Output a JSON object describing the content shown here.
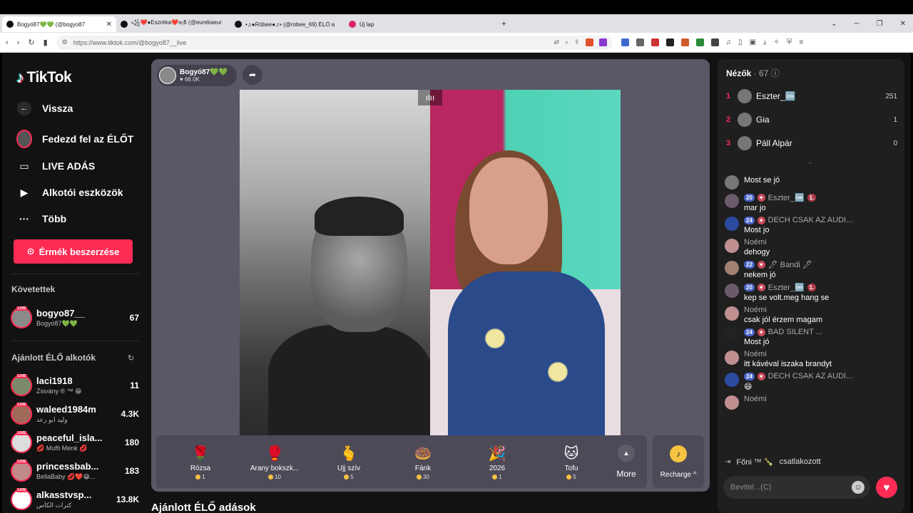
{
  "browser": {
    "tabs": [
      {
        "title": "Bogyó87💚💚 (@bogyo87"
      },
      {
        "title": "꧁❤️●Eszrèka❤️ʜ¡ϐ (@eurekaeur"
      },
      {
        "title": "•♫●Röbee●♫• (@robee_69) ÉLŐ a"
      },
      {
        "title": "Új lap"
      }
    ],
    "url": "https://www.tiktok.com/@bogyo87__live"
  },
  "sidebar": {
    "logo": "TikTok",
    "back": "Vissza",
    "explore": "Fedezd fel az ÉLŐT",
    "live": "LIVE ADÁS",
    "creator_tools": "Alkotói eszközök",
    "more": "Több",
    "coins_button": "Érmék beszerzése",
    "following_title": "Követettek",
    "following": [
      {
        "name": "bogyo87__",
        "sub": "Bogyó87💚💚",
        "count": "67",
        "color": "#8a8a8a"
      }
    ],
    "recommended_title": "Ajánlott ÉLŐ alkotók",
    "recommended": [
      {
        "name": "laci1918",
        "sub": "Zsivány ® ™ 😁",
        "count": "11",
        "color": "#7a8a6a"
      },
      {
        "name": "waleed1984m",
        "sub": "وليد ابو رعد",
        "count": "4.3K",
        "color": "#a06a5a"
      },
      {
        "name": "peaceful_isla...",
        "sub": "💋 Mufti Menk 💋",
        "count": "180",
        "color": "#ddd"
      },
      {
        "name": "princessbab...",
        "sub": "BellaBaby 💋❤️😁...",
        "count": "183",
        "color": "#c08a8a"
      },
      {
        "name": "alkasstvsp...",
        "sub": "كترات الكأس",
        "count": "13.8K",
        "color": "#fff"
      }
    ]
  },
  "stage": {
    "host_name": "Bogyó87💚💚",
    "host_likes": "♥ 66.0K",
    "gifts": [
      {
        "name": "Rózsa",
        "price": "1",
        "emoji": "🌹"
      },
      {
        "name": "Arany bokszk...",
        "price": "10",
        "emoji": "🥊"
      },
      {
        "name": "Ujj szív",
        "price": "5",
        "emoji": "🫰"
      },
      {
        "name": "Fánk",
        "price": "30",
        "emoji": "🍩"
      },
      {
        "name": "2026",
        "price": "1",
        "emoji": "🎉"
      },
      {
        "name": "Tofu",
        "price": "5",
        "emoji": "🐱"
      }
    ],
    "more_label": "More",
    "recharge_label": "Recharge ^",
    "section_below": "Ajánlott ÉLŐ adások"
  },
  "panel": {
    "viewers_label": "Nézők",
    "viewers_count": "· 67",
    "top_viewers": [
      {
        "rank": "1",
        "name": "Eszter_🆒",
        "score": "251"
      },
      {
        "rank": "2",
        "name": "Gia",
        "score": "1"
      },
      {
        "rank": "3",
        "name": "Páll Alpár",
        "score": "0"
      }
    ],
    "messages": [
      {
        "user": "",
        "level": "",
        "rank": "",
        "text": "Most se jó",
        "color": "#777"
      },
      {
        "user": "Eszter_🆒",
        "level": "20",
        "rank": "1.",
        "text": "mar jo",
        "color": "#6a5a6a"
      },
      {
        "user": "DECH CSAK AZ AUDI...",
        "level": "24",
        "rank": "",
        "text": "Most jo",
        "color": "#2a4aa0"
      },
      {
        "user": "Noémi",
        "level": "",
        "rank": "",
        "text": "dehogy",
        "color": "#c09090"
      },
      {
        "user": "🖊 Bandi 🖊",
        "level": "22",
        "rank": "",
        "text": "nekem jó",
        "color": "#a08070"
      },
      {
        "user": "Eszter_🆒",
        "level": "20",
        "rank": "1.",
        "text": "kep se volt.meg hang se",
        "color": "#6a5a6a"
      },
      {
        "user": "Noémi",
        "level": "",
        "rank": "",
        "text": "csak jól érzem magam",
        "color": "#c09090"
      },
      {
        "user": "BAD SILENT ...",
        "level": "24",
        "rank": "",
        "text": "Most jó",
        "color": "#222"
      },
      {
        "user": "Noémi",
        "level": "",
        "rank": "",
        "text": "itt kávéval iszaka brandyt",
        "color": "#c09090"
      },
      {
        "user": "DECH CSAK AZ AUDI...",
        "level": "24",
        "rank": "",
        "text": "😄",
        "color": "#2a4aa0"
      },
      {
        "user": "Noémi",
        "level": "",
        "rank": "",
        "text": "",
        "color": "#c09090"
      }
    ],
    "joined_user": "Főni ™ 🍾",
    "joined_text": "csatlakozott",
    "input_placeholder": "Bevitel...(C)"
  }
}
